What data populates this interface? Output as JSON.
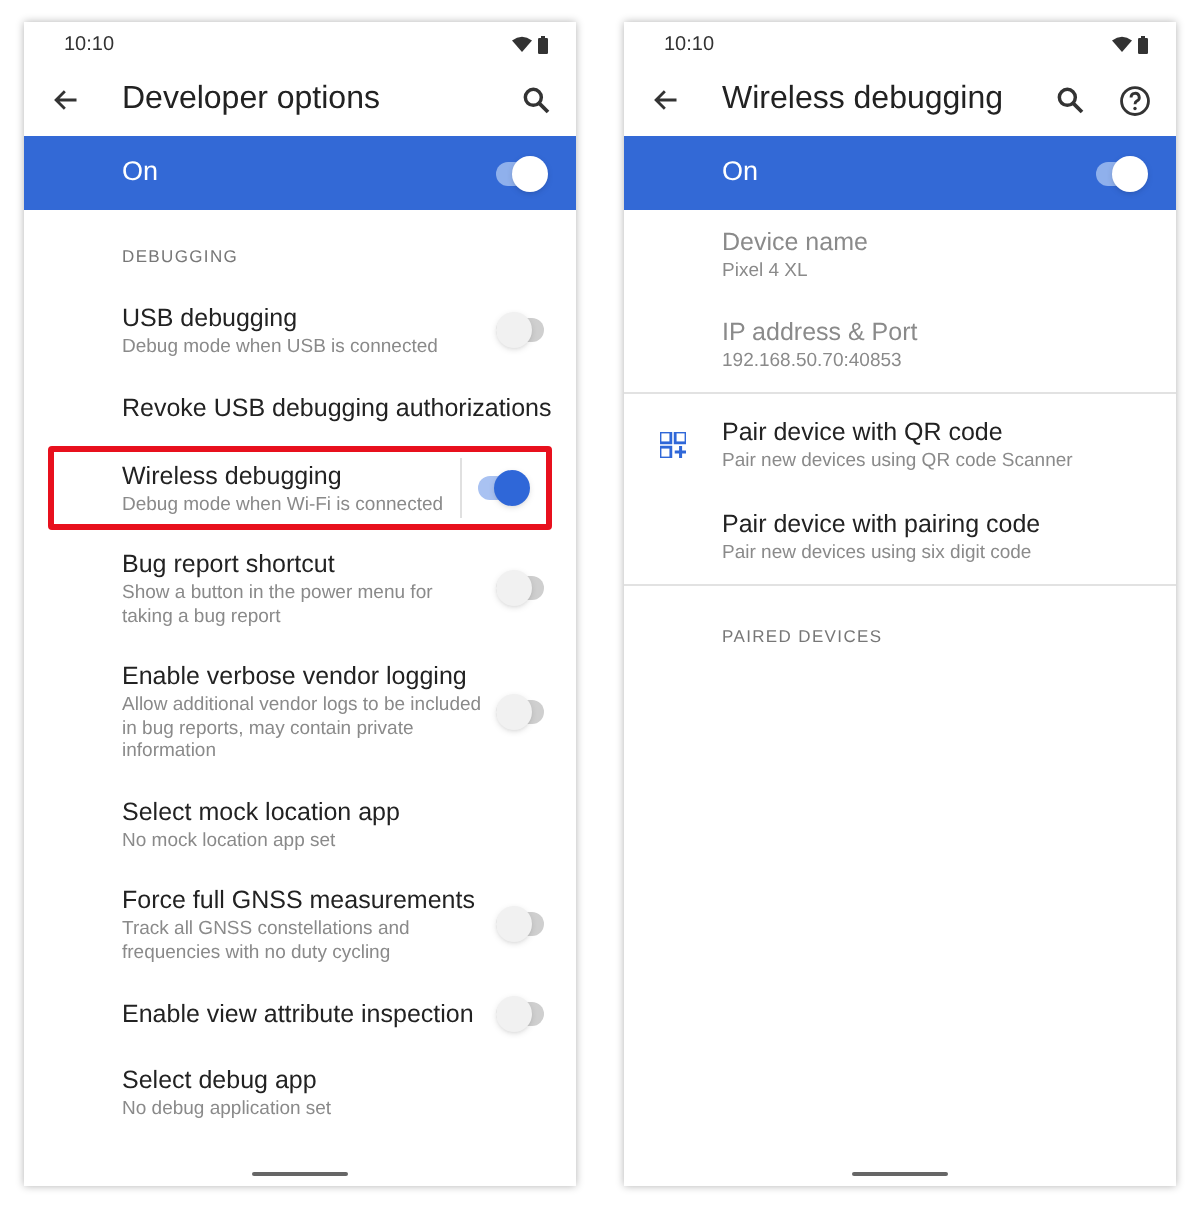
{
  "screens": [
    {
      "status_time": "10:10",
      "title": "Developer options",
      "actions": [
        {
          "kind": "search"
        }
      ],
      "master": {
        "label": "On",
        "on": true
      },
      "items": [
        {
          "kind": "header",
          "label": "DEBUGGING"
        },
        {
          "kind": "switch",
          "title": "USB debugging",
          "summary": "Debug mode when USB is connected",
          "on": false,
          "split": false,
          "highlighted": false
        },
        {
          "kind": "plain",
          "title": "Revoke USB debugging authorizations"
        },
        {
          "kind": "switch",
          "title": "Wireless debugging",
          "summary": "Debug mode when Wi-Fi is connected",
          "on": true,
          "split": true,
          "highlighted": true
        },
        {
          "kind": "switch",
          "title": "Bug report shortcut",
          "summary": "Show a button in the power menu for taking a bug report",
          "on": false,
          "split": false,
          "highlighted": false
        },
        {
          "kind": "switch",
          "title": "Enable verbose vendor logging",
          "summary": "Allow additional vendor logs to be included in bug reports, may contain private information",
          "on": false,
          "split": false,
          "highlighted": false
        },
        {
          "kind": "plain",
          "title": "Select mock location app",
          "summary": "No mock location app set"
        },
        {
          "kind": "switch",
          "title": "Force full GNSS measurements",
          "summary": "Track all GNSS constellations and frequencies with no duty cycling",
          "on": false,
          "split": false,
          "highlighted": false
        },
        {
          "kind": "switch",
          "title": "Enable view attribute inspection",
          "on": false,
          "split": false,
          "highlighted": false
        },
        {
          "kind": "plain",
          "title": "Select debug app",
          "summary": "No debug application set"
        }
      ]
    },
    {
      "status_time": "10:10",
      "title": "Wireless debugging",
      "actions": [
        {
          "kind": "search"
        },
        {
          "kind": "help"
        }
      ],
      "master": {
        "label": "On",
        "on": true
      },
      "items": [
        {
          "kind": "info",
          "title": "Device name",
          "summary": "Pixel 4 XL"
        },
        {
          "kind": "info",
          "title": "IP address & Port",
          "summary": "192.168.50.70:40853"
        },
        {
          "kind": "divider"
        },
        {
          "kind": "qr",
          "title": "Pair device with QR code",
          "summary": "Pair new devices using QR code Scanner"
        },
        {
          "kind": "plain",
          "title": "Pair device with pairing code",
          "summary": "Pair new devices using six digit code"
        },
        {
          "kind": "divider"
        },
        {
          "kind": "header",
          "label": "PAIRED DEVICES"
        }
      ]
    }
  ]
}
